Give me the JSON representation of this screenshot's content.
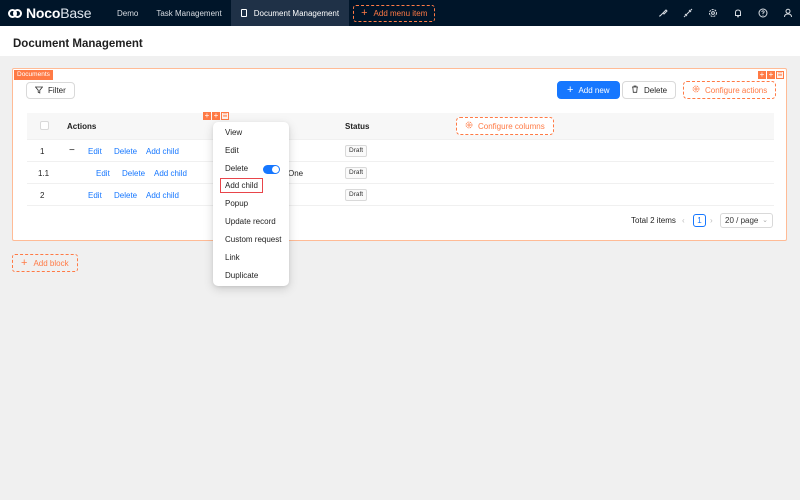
{
  "topbar": {
    "logo_bold": "Noco",
    "logo_light": "Base",
    "menu": [
      "Demo",
      "Task Management",
      "Document Management"
    ],
    "add_menu_item": "Add menu item",
    "icons": [
      "brush-icon",
      "plugin-icon",
      "settings-gear-icon",
      "bell-icon",
      "help-circle-icon",
      "user-icon"
    ]
  },
  "page": {
    "title": "Document Management"
  },
  "block": {
    "tag": "Documents",
    "filter_label": "Filter",
    "add_new_label": "Add new",
    "delete_label": "Delete",
    "configure_actions_label": "Configure actions",
    "configure_columns_label": "Configure columns",
    "columns": [
      "Actions",
      "Status"
    ],
    "rows": [
      {
        "id": "1",
        "collapse": "−",
        "actions": [
          "Edit",
          "Delete",
          "Add child"
        ],
        "title": "",
        "status": "Draft"
      },
      {
        "id": "1.1",
        "collapse": "",
        "actions": [
          "Edit",
          "Delete",
          "Add child"
        ],
        "title": "One",
        "status": "Draft"
      },
      {
        "id": "2",
        "collapse": "",
        "actions": [
          "Edit",
          "Delete",
          "Add child"
        ],
        "title": "",
        "status": "Draft"
      }
    ],
    "pagination": {
      "total_label": "Total 2 items",
      "current_page": "1",
      "page_size": "20 / page"
    }
  },
  "add_block_label": "Add block",
  "dropdown": {
    "items": [
      "View",
      "Edit",
      "Delete",
      "Add child",
      "Popup",
      "Update record",
      "Custom request",
      "Link",
      "Duplicate"
    ],
    "highlighted": "Add child",
    "delete_toggle_on": true
  },
  "colors": {
    "nav_bg": "#001529",
    "primary": "#1677ff",
    "designer_orange": "#ff7a45",
    "highlight_red": "#e8454a"
  }
}
